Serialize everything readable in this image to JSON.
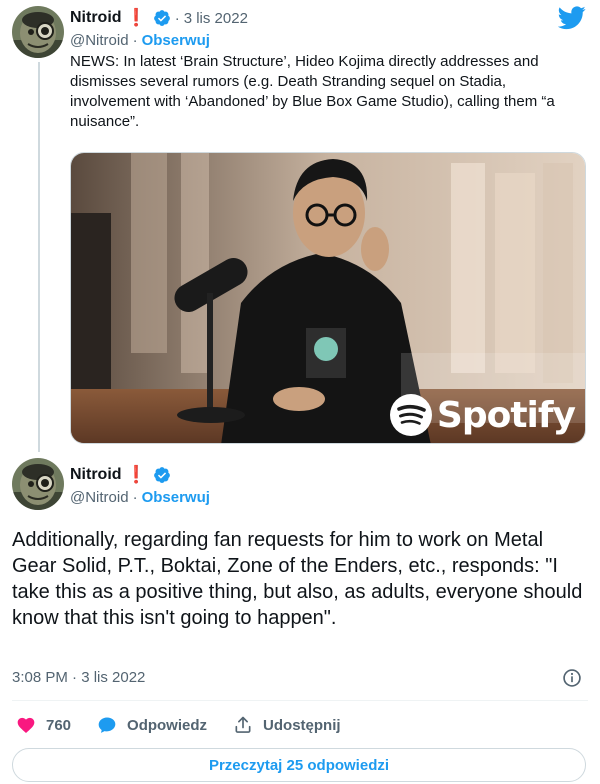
{
  "tweet1": {
    "name": "Nitroid",
    "badge": "❗",
    "date": "3 lis 2022",
    "handle": "@Nitroid",
    "follow": "Obserwuj",
    "text": "NEWS: In latest ‘Brain Structure’, Hideo Kojima directly addresses and dismisses several rumors (e.g. Death Stranding sequel on Stadia, involvement with ‘Abandoned’ by Blue Box Game Studio), calling them “a nuisance”.",
    "media": {
      "description_icon": "photo",
      "watermark": "Spotify"
    }
  },
  "tweet2": {
    "name": "Nitroid",
    "badge": "❗",
    "handle": "@Nitroid",
    "follow": "Obserwuj",
    "text": "Additionally, regarding fan requests for him to work on Metal Gear Solid, P.T., Boktai, Zone of the Enders, etc., responds: \"I take this as a positive thing, but also, as adults, everyone should know that this isn't going to happen\".",
    "timestamp": "3:08 PM · 3 lis 2022"
  },
  "actions": {
    "likes": "760",
    "reply": "Odpowiedz",
    "share": "Udostępnij"
  },
  "read_replies": "Przeczytaj 25 odpowiedzi",
  "colors": {
    "accent": "#1d9bf0",
    "like": "#f91880",
    "text": "#0f1419",
    "muted": "#536471"
  },
  "icons": [
    "twitter-bird-icon",
    "verified-icon",
    "heart-icon",
    "reply-icon",
    "share-icon",
    "info-icon",
    "spotify-icon"
  ]
}
